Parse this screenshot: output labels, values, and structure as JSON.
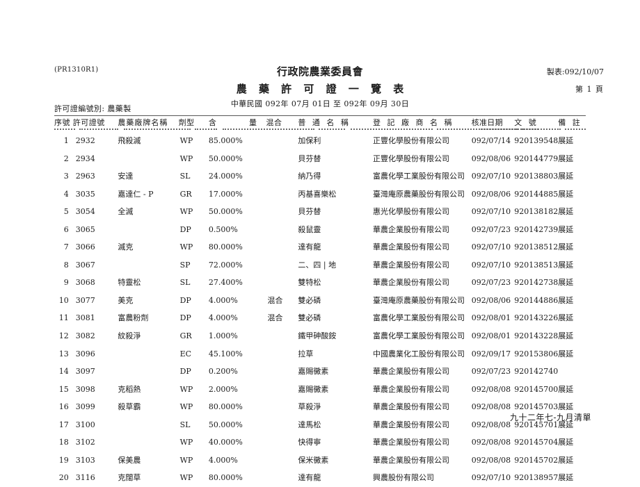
{
  "header": {
    "report_code": "(PR1310R1)",
    "agency": "行政院農業委員會",
    "title": "農 藥 許 可 證 一 覽 表",
    "period": "中華民國 092年 07月 01日 至 092年 09月 30日",
    "print_date": "製表:092/10/07",
    "page_label": "第    1 頁",
    "cert_kind": "許可證編號別: 農藥製"
  },
  "columns": {
    "seq": "序號",
    "cert_no": "許可證號",
    "brand": "農藥廠牌名稱",
    "formulation": "劑型",
    "amount": "含",
    "amount2": "量",
    "mixed": "混合",
    "common_name": "普 通 名 稱",
    "maker": "登 記 廠 商 名 稱",
    "approve_date": "核准日期",
    "doc_no": "文 號",
    "memo": "備 註"
  },
  "rows": [
    {
      "seq": "1",
      "cert_no": "2932",
      "brand": "飛殺滅",
      "formulation": "WP",
      "amount": "85.000%",
      "mixed": "",
      "common_name": "加保利",
      "maker": "正豐化學股份有限公司",
      "approve_date": "092/07/14",
      "doc_no": "920139548",
      "memo": "展延"
    },
    {
      "seq": "2",
      "cert_no": "2934",
      "brand": "",
      "formulation": "WP",
      "amount": "50.000%",
      "mixed": "",
      "common_name": "貝芬替",
      "maker": "正豐化學股份有限公司",
      "approve_date": "092/08/06",
      "doc_no": "920144779",
      "memo": "展延"
    },
    {
      "seq": "3",
      "cert_no": "2963",
      "brand": "安達",
      "formulation": "SL",
      "amount": "24.000%",
      "mixed": "",
      "common_name": "納乃得",
      "maker": "富農化學工業股份有限公司",
      "approve_date": "092/07/10",
      "doc_no": "920138803",
      "memo": "展延"
    },
    {
      "seq": "4",
      "cert_no": "3035",
      "brand": "嘉達仁 - P",
      "formulation": "GR",
      "amount": "17.000%",
      "mixed": "",
      "common_name": "丙基喜樂松",
      "maker": "臺灣庵原農藥股份有限公司",
      "approve_date": "092/08/06",
      "doc_no": "920144885",
      "memo": "展延"
    },
    {
      "seq": "5",
      "cert_no": "3054",
      "brand": "全滅",
      "formulation": "WP",
      "amount": "50.000%",
      "mixed": "",
      "common_name": "貝芬替",
      "maker": "惠光化學股份有限公司",
      "approve_date": "092/07/10",
      "doc_no": "920138182",
      "memo": "展延"
    },
    {
      "seq": "6",
      "cert_no": "3065",
      "brand": "",
      "formulation": "DP",
      "amount": "0.500%",
      "mixed": "",
      "common_name": "殺鼠靈",
      "maker": "華農企業股份有限公司",
      "approve_date": "092/07/23",
      "doc_no": "920142739",
      "memo": "展延"
    },
    {
      "seq": "7",
      "cert_no": "3066",
      "brand": "滅克",
      "formulation": "WP",
      "amount": "80.000%",
      "mixed": "",
      "common_name": "達有龍",
      "maker": "華農企業股份有限公司",
      "approve_date": "092/07/10",
      "doc_no": "920138512",
      "memo": "展延"
    },
    {
      "seq": "8",
      "cert_no": "3067",
      "brand": "",
      "formulation": "SP",
      "amount": "72.000%",
      "mixed": "",
      "common_name": "二、四 | 地",
      "maker": "華農企業股份有限公司",
      "approve_date": "092/07/10",
      "doc_no": "920138513",
      "memo": "展延"
    },
    {
      "seq": "9",
      "cert_no": "3068",
      "brand": "特靈松",
      "formulation": "SL",
      "amount": "27.400%",
      "mixed": "",
      "common_name": "雙特松",
      "maker": "華農企業股份有限公司",
      "approve_date": "092/07/23",
      "doc_no": "920142738",
      "memo": "展延"
    },
    {
      "seq": "10",
      "cert_no": "3077",
      "brand": "美克",
      "formulation": "DP",
      "amount": "4.000%",
      "mixed": "混合",
      "common_name": "雙必磷",
      "maker": "臺灣庵原農藥股份有限公司",
      "approve_date": "092/08/06",
      "doc_no": "920144886",
      "memo": "展延"
    },
    {
      "seq": "11",
      "cert_no": "3081",
      "brand": "富農粉劑",
      "formulation": "DP",
      "amount": "4.000%",
      "mixed": "混合",
      "common_name": "雙必磷",
      "maker": "富農化學工業股份有限公司",
      "approve_date": "092/08/01",
      "doc_no": "920143226",
      "memo": "展延"
    },
    {
      "seq": "12",
      "cert_no": "3082",
      "brand": "紋殺淨",
      "formulation": "GR",
      "amount": "1.000%",
      "mixed": "",
      "common_name": "鐵甲砷酸銨",
      "maker": "富農化學工業股份有限公司",
      "approve_date": "092/08/01",
      "doc_no": "920143228",
      "memo": "展延"
    },
    {
      "seq": "13",
      "cert_no": "3096",
      "brand": "",
      "formulation": "EC",
      "amount": "45.100%",
      "mixed": "",
      "common_name": "拉草",
      "maker": "中國農業化工股份有限公司",
      "approve_date": "092/09/17",
      "doc_no": "920153806",
      "memo": "展延"
    },
    {
      "seq": "14",
      "cert_no": "3097",
      "brand": "",
      "formulation": "DP",
      "amount": "0.200%",
      "mixed": "",
      "common_name": "嘉賜黴素",
      "maker": "華農企業股份有限公司",
      "approve_date": "092/07/23",
      "doc_no": "920142740",
      "memo": ""
    },
    {
      "seq": "15",
      "cert_no": "3098",
      "brand": "克稻熱",
      "formulation": "WP",
      "amount": "2.000%",
      "mixed": "",
      "common_name": "嘉賜黴素",
      "maker": "華農企業股份有限公司",
      "approve_date": "092/08/08",
      "doc_no": "920145700",
      "memo": "展延"
    },
    {
      "seq": "16",
      "cert_no": "3099",
      "brand": "殺草霸",
      "formulation": "WP",
      "amount": "80.000%",
      "mixed": "",
      "common_name": "草殺淨",
      "maker": "華農企業股份有限公司",
      "approve_date": "092/08/08",
      "doc_no": "920145703",
      "memo": "展延"
    },
    {
      "seq": "17",
      "cert_no": "3100",
      "brand": "",
      "formulation": "SL",
      "amount": "50.000%",
      "mixed": "",
      "common_name": "達馬松",
      "maker": "華農企業股份有限公司",
      "approve_date": "092/08/08",
      "doc_no": "920145701",
      "memo": "展延"
    },
    {
      "seq": "18",
      "cert_no": "3102",
      "brand": "",
      "formulation": "WP",
      "amount": "40.000%",
      "mixed": "",
      "common_name": "快得寧",
      "maker": "華農企業股份有限公司",
      "approve_date": "092/08/08",
      "doc_no": "920145704",
      "memo": "展延"
    },
    {
      "seq": "19",
      "cert_no": "3103",
      "brand": "保美農",
      "formulation": "WP",
      "amount": "4.000%",
      "mixed": "",
      "common_name": "保米黴素",
      "maker": "華農企業股份有限公司",
      "approve_date": "092/08/08",
      "doc_no": "920145702",
      "memo": "展延"
    },
    {
      "seq": "20",
      "cert_no": "3116",
      "brand": "克闊草",
      "formulation": "WP",
      "amount": "80.000%",
      "mixed": "",
      "common_name": "達有龍",
      "maker": "興農股份有限公司",
      "approve_date": "092/07/10",
      "doc_no": "920138957",
      "memo": "展延"
    }
  ],
  "footer": {
    "note": "九十二年七-九月清單"
  }
}
